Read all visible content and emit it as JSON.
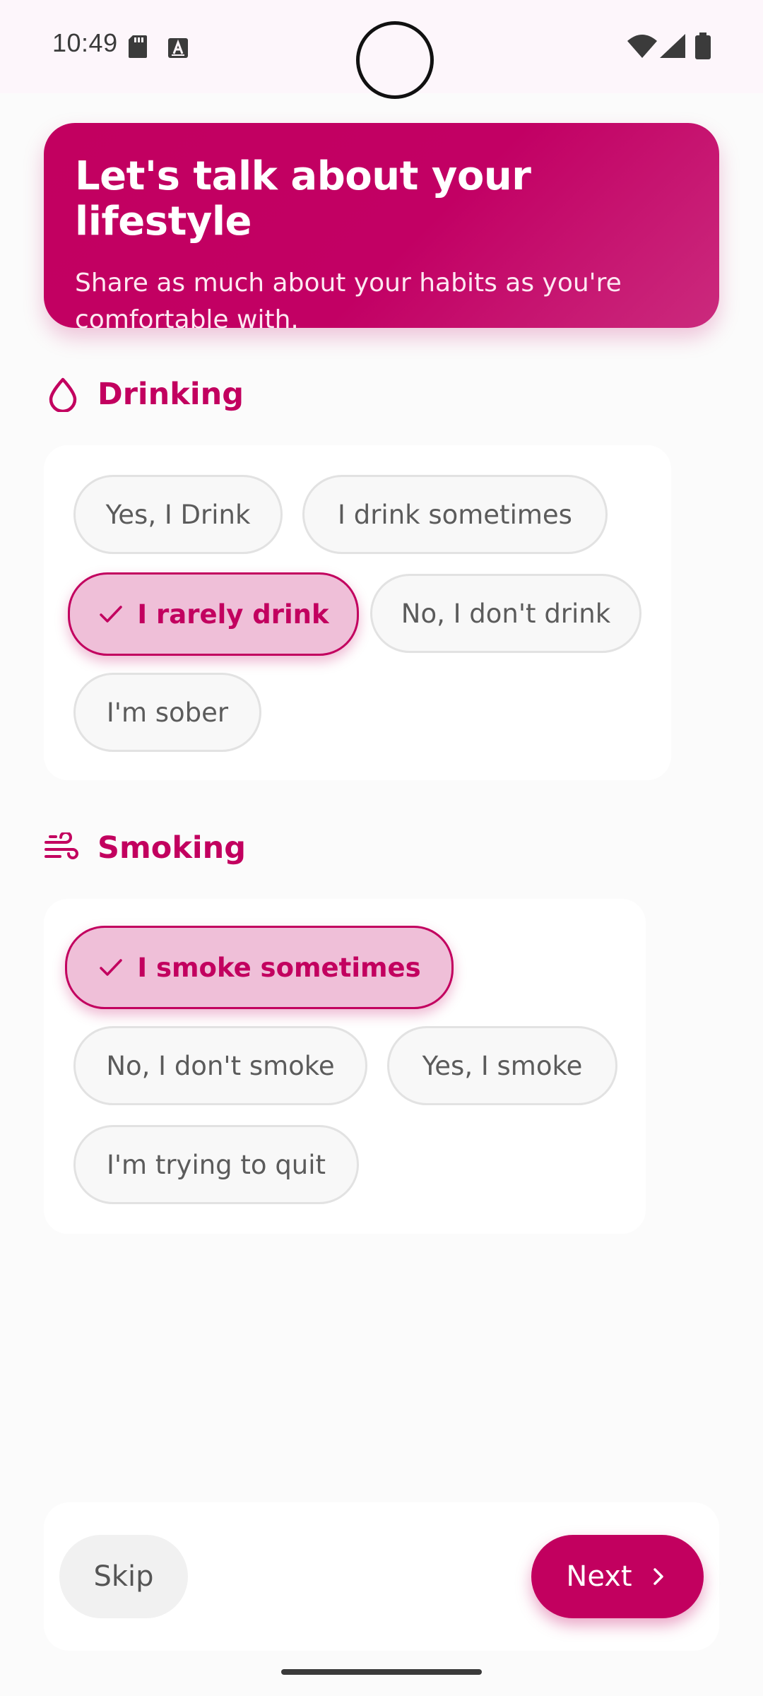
{
  "status_bar": {
    "time": "10:49",
    "icons": [
      "sd-card-icon",
      "text-a-icon",
      "wifi-icon",
      "signal-icon",
      "battery-icon"
    ]
  },
  "header": {
    "title": "Let's talk about your lifestyle",
    "subtitle": "Share as much about your habits as you're comfortable with."
  },
  "drinking": {
    "title": "Drinking",
    "icon": "droplet-icon",
    "options": [
      {
        "label": "Yes, I Drink",
        "selected": false
      },
      {
        "label": "I drink sometimes",
        "selected": false
      },
      {
        "label": "I rarely drink",
        "selected": true
      },
      {
        "label": "No, I don't drink",
        "selected": false
      },
      {
        "label": "I'm sober",
        "selected": false
      }
    ]
  },
  "smoking": {
    "title": "Smoking",
    "icon": "wind-icon",
    "options": [
      {
        "label": "I smoke sometimes",
        "selected": true
      },
      {
        "label": "No, I don't smoke",
        "selected": false
      },
      {
        "label": "Yes, I smoke",
        "selected": false
      },
      {
        "label": "I'm trying to quit",
        "selected": false
      }
    ]
  },
  "footer": {
    "skip_label": "Skip",
    "next_label": "Next"
  },
  "colors": {
    "accent": "#c2005f",
    "selected_chip_bg": "#efbfd8",
    "chip_bg": "#f8f8f8",
    "background": "#fbfbfb"
  }
}
